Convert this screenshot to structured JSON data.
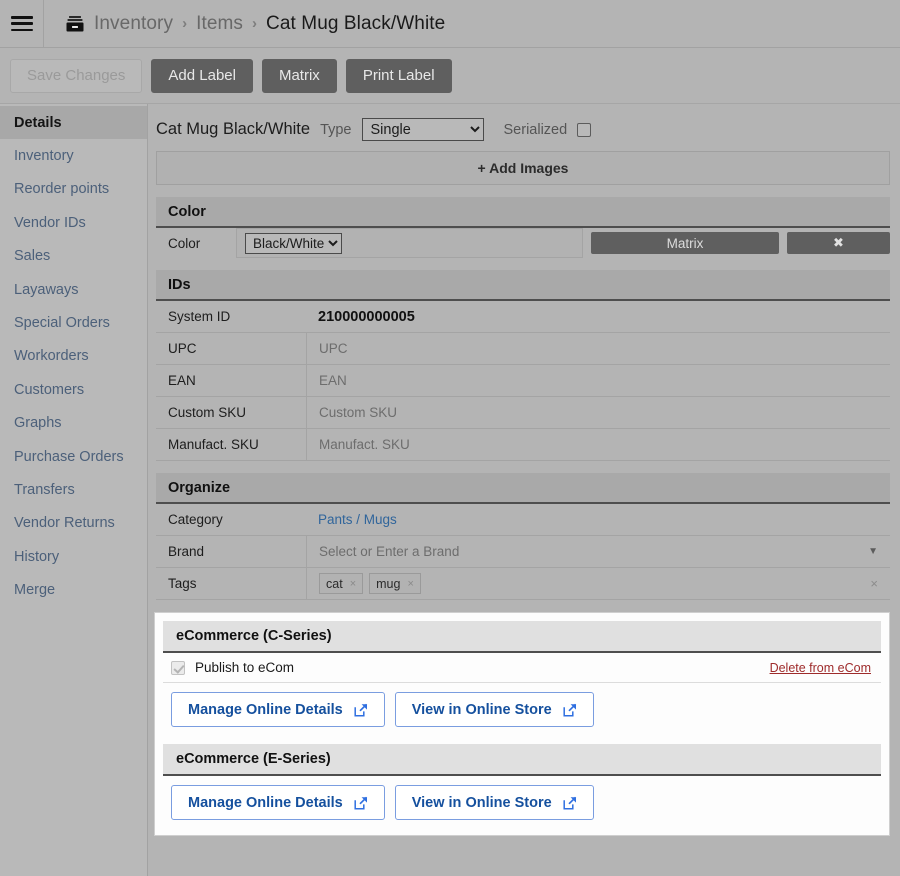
{
  "topbar": {
    "menu_icon": "hamburger-menu-icon",
    "breadcrumb_icon": "inventory-box-icon",
    "separator": "›",
    "breadcrumbs": [
      {
        "label": "Inventory"
      },
      {
        "label": "Items"
      },
      {
        "label": "Cat Mug Black/White"
      }
    ]
  },
  "toolbar": {
    "save_label": "Save Changes",
    "add_label": "Add Label",
    "matrix_label": "Matrix",
    "print_label": "Print Label"
  },
  "sidebar": {
    "items": [
      {
        "label": "Details"
      },
      {
        "label": "Inventory"
      },
      {
        "label": "Reorder points"
      },
      {
        "label": "Vendor IDs"
      },
      {
        "label": "Sales"
      },
      {
        "label": "Layaways"
      },
      {
        "label": "Special Orders"
      },
      {
        "label": "Workorders"
      },
      {
        "label": "Customers"
      },
      {
        "label": "Graphs"
      },
      {
        "label": "Purchase Orders"
      },
      {
        "label": "Transfers"
      },
      {
        "label": "Vendor Returns"
      },
      {
        "label": "History"
      },
      {
        "label": "Merge"
      }
    ]
  },
  "item_header": {
    "title": "Cat Mug Black/White",
    "type_label": "Type",
    "type_value": "Single",
    "type_options": [
      "Single"
    ],
    "serialized_label": "Serialized",
    "serialized_checked": false
  },
  "add_images": {
    "label": "+ Add Images"
  },
  "color_panel": {
    "title": "Color",
    "row_label": "Color",
    "value": "Black/White",
    "options": [
      "Black/White"
    ],
    "matrix_button": "Matrix",
    "remove_button": "✖"
  },
  "ids_panel": {
    "title": "IDs",
    "rows": [
      {
        "label": "System ID",
        "value": "210000000005",
        "placeholder": "",
        "strong": true
      },
      {
        "label": "UPC",
        "value": "",
        "placeholder": "UPC",
        "strong": false
      },
      {
        "label": "EAN",
        "value": "",
        "placeholder": "EAN",
        "strong": false
      },
      {
        "label": "Custom SKU",
        "value": "",
        "placeholder": "Custom SKU",
        "strong": false
      },
      {
        "label": "Manufact. SKU",
        "value": "",
        "placeholder": "Manufact. SKU",
        "strong": false
      }
    ]
  },
  "organize_panel": {
    "title": "Organize",
    "category_label": "Category",
    "category_value": "Pants / Mugs",
    "brand_label": "Brand",
    "brand_placeholder": "Select or Enter a Brand",
    "brand_caret": "▼",
    "tags_label": "Tags",
    "tags": [
      {
        "label": "cat",
        "remove": "×"
      },
      {
        "label": "mug",
        "remove": "×"
      }
    ],
    "tags_clear": "×"
  },
  "ecommerce": [
    {
      "title": "eCommerce (C-Series)",
      "has_publish_row": true,
      "publish_label": "Publish to eCom",
      "publish_checked": true,
      "delete_link": "Delete from eCom",
      "manage_button": "Manage Online Details",
      "view_button": "View in Online Store",
      "external_icon": "external-link-icon"
    },
    {
      "title": "eCommerce (E-Series)",
      "has_publish_row": false,
      "publish_label": "",
      "publish_checked": false,
      "delete_link": "",
      "manage_button": "Manage Online Details",
      "view_button": "View in Online Store",
      "external_icon": "external-link-icon"
    }
  ],
  "colors": {
    "page_bg": "#b4b4b4",
    "panel_header": "#a9a9a9",
    "dark_button": "#5f5f5f",
    "link_blue": "#30659b",
    "ecom_link_blue": "#15509e",
    "delete_red": "#9e2b2b",
    "sidebar_link": "#4c607a"
  }
}
